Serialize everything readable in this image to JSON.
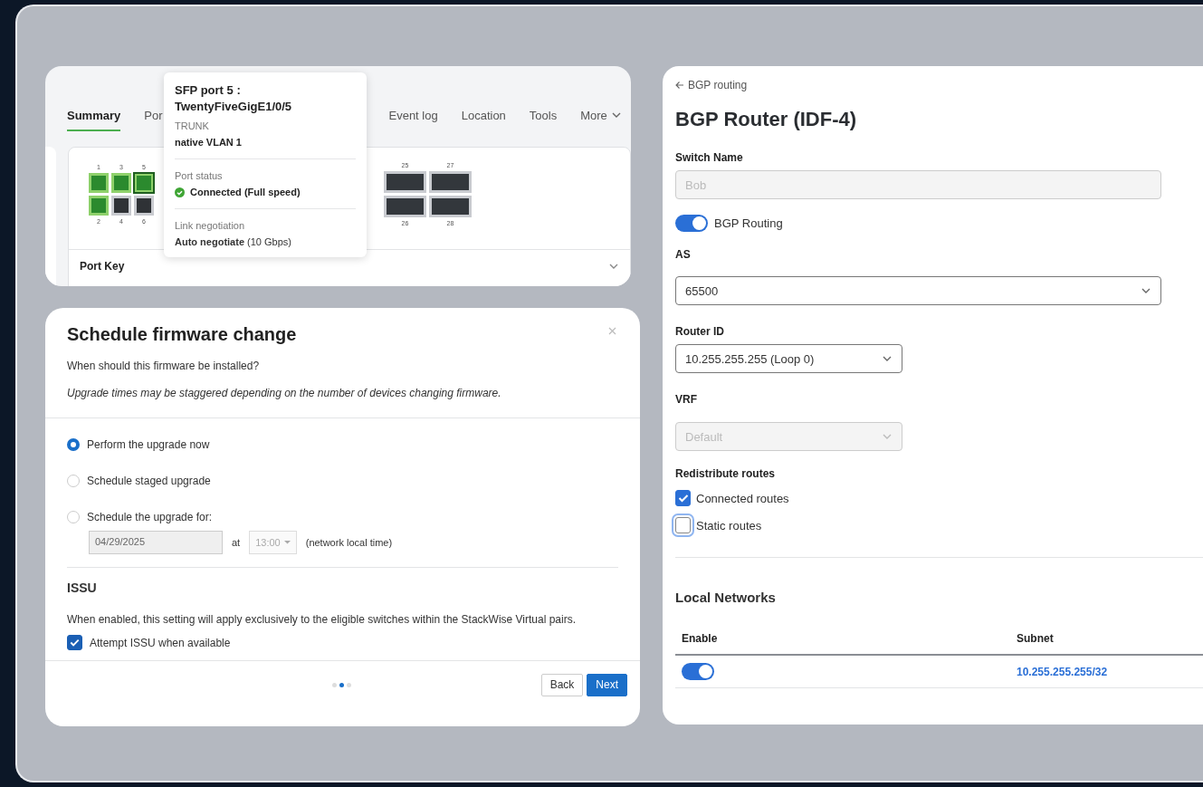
{
  "port_panel": {
    "tabs": [
      {
        "label": "Summary",
        "selected": true
      },
      {
        "label": "Por",
        "selected": false
      },
      {
        "label": "Event log",
        "selected": false
      },
      {
        "label": "Location",
        "selected": false
      },
      {
        "label": "Tools",
        "selected": false
      },
      {
        "label": "More",
        "selected": false
      }
    ],
    "top_ports": [
      {
        "number": "1",
        "kind": "port",
        "connected": true,
        "selected": false
      },
      {
        "number": "3",
        "kind": "port",
        "connected": true,
        "selected": false
      },
      {
        "number": "5",
        "kind": "port",
        "connected": true,
        "selected": true
      },
      {
        "number": "25",
        "kind": "module",
        "connected": false,
        "selected": false
      },
      {
        "number": "27",
        "kind": "module",
        "connected": false,
        "selected": false
      }
    ],
    "bottom_ports": [
      {
        "number": "2",
        "kind": "port",
        "connected": true,
        "selected": false
      },
      {
        "number": "4",
        "kind": "port",
        "connected": false,
        "selected": false
      },
      {
        "number": "6",
        "kind": "port",
        "connected": false,
        "selected": false
      },
      {
        "number": "26",
        "kind": "module",
        "connected": false,
        "selected": false
      },
      {
        "number": "28",
        "kind": "module",
        "connected": false,
        "selected": false
      }
    ],
    "port_key": "Port Key",
    "tooltip": {
      "title": "SFP port 5 : TwentyFiveGigE1/0/5",
      "mode": "TRUNK",
      "vlan": "native VLAN 1",
      "status_label": "Port status",
      "status": "Connected (Full speed)",
      "negotiation_label": "Link negotiation",
      "negotiation": "**Auto negotiate** (10 Gbps)"
    }
  },
  "firmware_dialog": {
    "title": "Schedule firmware change",
    "question": "When should this firmware be installed?",
    "note": "Upgrade times may be staggered depending on the number of devices changing firmware.",
    "options": [
      {
        "label": "Perform the upgrade now",
        "selected": true
      },
      {
        "label": "Schedule staged upgrade",
        "selected": false
      },
      {
        "label": "Schedule the upgrade for:",
        "selected": false
      }
    ],
    "schedule": {
      "date": "04/29/2025",
      "at": "at",
      "time": "13:00",
      "zone": "(network local time)",
      "disabled": true
    },
    "issu": {
      "title": "ISSU",
      "description": "When enabled, this setting will apply exclusively to the eligible switches within the StackWise Virtual pairs.",
      "option": "Attempt ISSU when available",
      "checked": true
    },
    "pages": [
      {
        "selected": false
      },
      {
        "selected": true
      },
      {
        "selected": false
      }
    ],
    "buttons": [
      {
        "label": "Back",
        "kind": "secondary"
      },
      {
        "label": "Next",
        "kind": "primary"
      }
    ]
  },
  "bgp_router": {
    "back_link": "BGP routing",
    "title": "BGP Router (IDF-4)",
    "switch_name": {
      "label": "Switch Name",
      "value": "Bob",
      "disabled": true
    },
    "bgp_routing": {
      "label": "BGP Routing",
      "on": true
    },
    "as": {
      "label": "AS",
      "value": "65500",
      "disabled": false
    },
    "router_id": {
      "label": "Router ID",
      "value": "10.255.255.255 (Loop 0)",
      "disabled": false
    },
    "vrf": {
      "label": "VRF",
      "value": "Default",
      "disabled": true
    },
    "redistribute": {
      "label": "Redistribute routes",
      "options": [
        {
          "label": "Connected routes",
          "checked": true,
          "focused": false
        },
        {
          "label": "Static routes",
          "checked": false,
          "focused": true
        }
      ]
    },
    "local_networks": {
      "title": "Local Networks",
      "columns": [
        "Enable",
        "Subnet"
      ],
      "rows": [
        {
          "enabled": true,
          "subnet": "10.255.255.255/32"
        }
      ]
    }
  }
}
